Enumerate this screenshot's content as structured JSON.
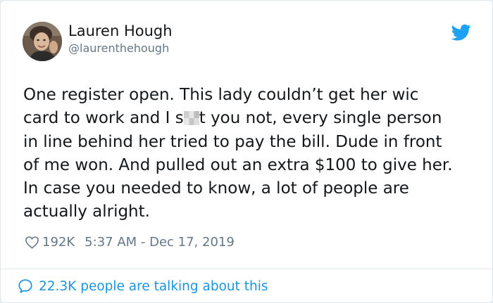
{
  "tweet": {
    "author": {
      "name": "Lauren Hough",
      "handle": "@laurenthehough"
    },
    "text_lines": [
      "One register open. This lady couldn’t get her wic",
      [
        "card to work and I s",
        "t you not, every single person"
      ],
      "in line behind her tried to pay the bill. Dude in front",
      "of me won. And pulled out an extra $100 to give her.",
      "In case you needed to know, a lot of people are",
      "actually alright."
    ],
    "likes": "192K",
    "timestamp": "5:37 AM - Dec 17, 2019",
    "footer_text": "22.3K people are talking about this"
  },
  "icons": {
    "brand": "twitter-bird-icon",
    "like": "heart-icon",
    "conversation": "speech-bubble-icon"
  },
  "colors": {
    "accent": "#1da1f2",
    "link": "#1b95e0",
    "text": "#14171a",
    "muted": "#657786"
  }
}
